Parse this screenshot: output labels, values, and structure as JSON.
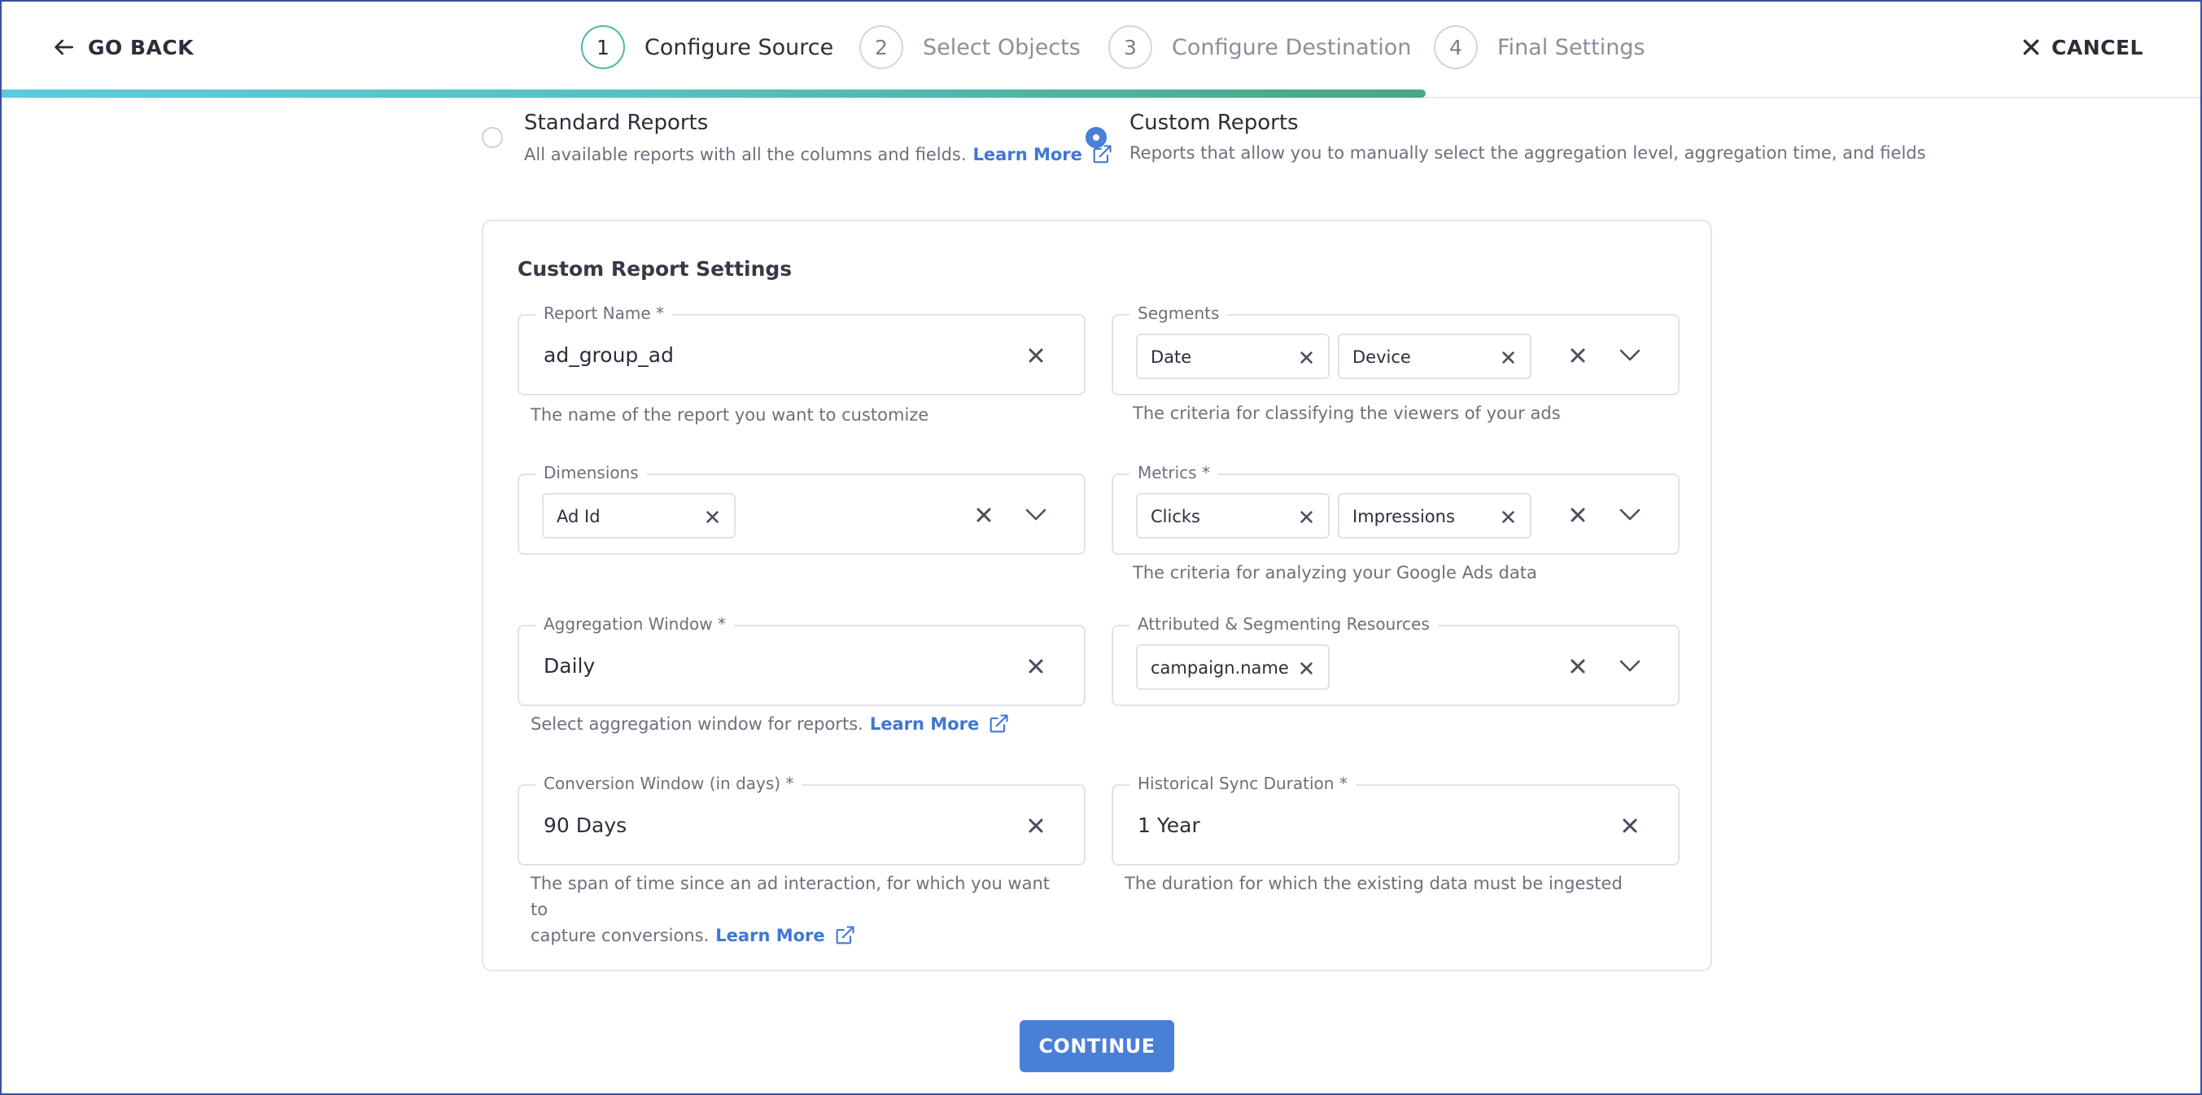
{
  "header": {
    "go_back_label": "GO BACK",
    "cancel_label": "CANCEL",
    "steps": [
      {
        "number": "1",
        "label": "Configure Source",
        "active": true
      },
      {
        "number": "2",
        "label": "Select Objects",
        "active": false
      },
      {
        "number": "3",
        "label": "Configure Destination",
        "active": false
      },
      {
        "number": "4",
        "label": "Final Settings",
        "active": false
      }
    ]
  },
  "report_types": {
    "standard": {
      "title": "Standard Reports",
      "description": "All available reports with all the columns and fields.",
      "learn_more": "Learn More",
      "selected": false
    },
    "custom": {
      "title": "Custom Reports",
      "description": "Reports that allow you to manually select the aggregation level, aggregation time, and fields",
      "selected": true
    }
  },
  "settings": {
    "title": "Custom Report Settings",
    "report_name": {
      "label": "Report Name *",
      "value": "ad_group_ad",
      "hint": "The name of the report you want to customize"
    },
    "segments": {
      "label": "Segments",
      "chips": [
        "Date",
        "Device"
      ],
      "hint": "The criteria for classifying the viewers of your ads"
    },
    "dimensions": {
      "label": "Dimensions",
      "chips": [
        "Ad Id"
      ]
    },
    "metrics": {
      "label": "Metrics *",
      "chips": [
        "Clicks",
        "Impressions"
      ],
      "hint": "The criteria for analyzing your Google Ads data"
    },
    "aggregation_window": {
      "label": "Aggregation Window *",
      "value": "Daily",
      "hint": "Select aggregation window for reports.",
      "learn_more": "Learn More"
    },
    "attributed_resources": {
      "label": "Attributed & Segmenting Resources",
      "chips": [
        "campaign.name"
      ]
    },
    "conversion_window": {
      "label": "Conversion Window (in days) *",
      "value": "90 Days",
      "hint_line1": "The span of time since an ad interaction, for which you want to",
      "hint_line2": "capture conversions.",
      "learn_more": "Learn More"
    },
    "historical_sync": {
      "label": "Historical Sync Duration *",
      "value": "1 Year",
      "hint": "The duration for which the existing data must be ingested"
    }
  },
  "footer": {
    "continue_label": "CONTINUE"
  },
  "colors": {
    "accent": "#4a7fd6",
    "active_step": "#4fb8a7",
    "link": "#3f77d5"
  }
}
